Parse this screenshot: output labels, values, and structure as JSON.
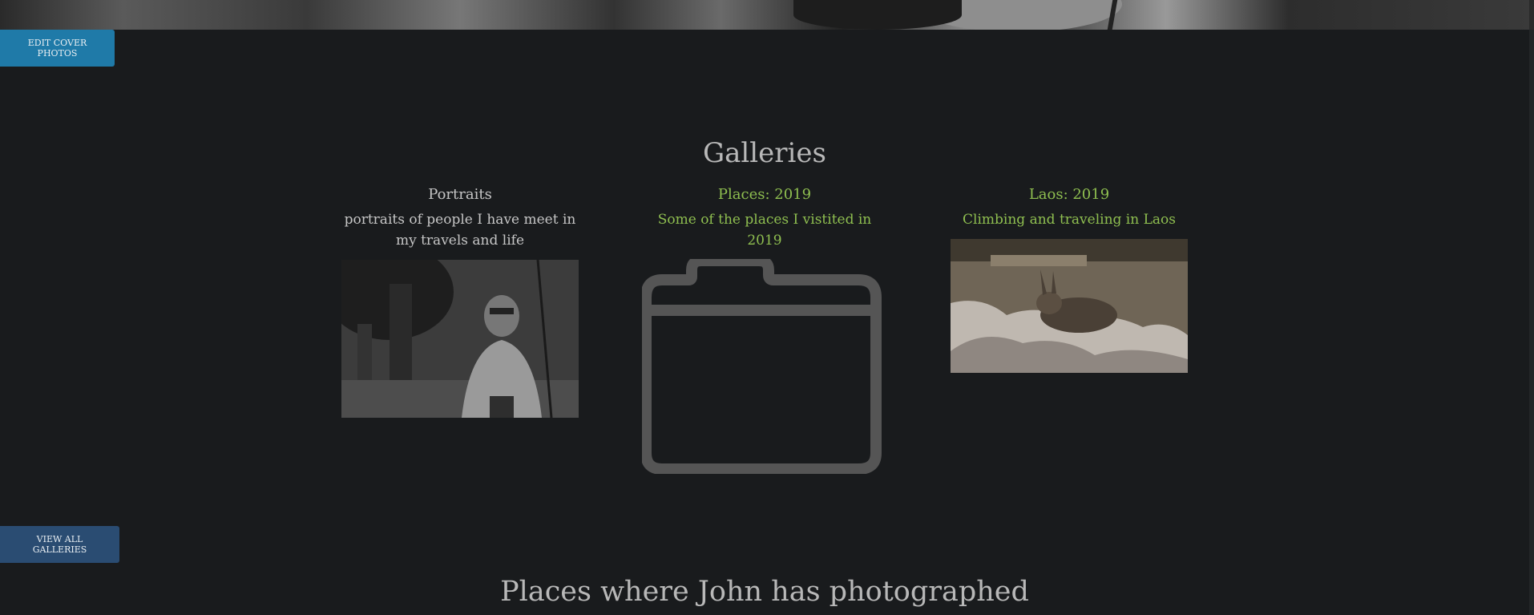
{
  "header": {
    "edit_cover_label": "EDIT COVER PHOTOS"
  },
  "galleries": {
    "heading": "Galleries",
    "items": [
      {
        "title": "Portraits",
        "description": "portraits of people I have meet in my travels and life",
        "thumbnail": "portrait-photo"
      },
      {
        "title": "Places: 2019",
        "description": "Some of the places I vistited in 2019",
        "thumbnail": "folder-icon"
      },
      {
        "title": "Laos: 2019",
        "description": "Climbing and traveling in Laos",
        "thumbnail": "laos-photo"
      }
    ],
    "view_all_label": "VIEW ALL GALLERIES"
  },
  "places": {
    "heading": "Places where John has photographed"
  },
  "colors": {
    "background": "#191b1d",
    "edit_button": "#1f7aa8",
    "view_button": "#2a4c72",
    "link_green": "#8fbf50",
    "text_gray": "#bdbdbd"
  }
}
